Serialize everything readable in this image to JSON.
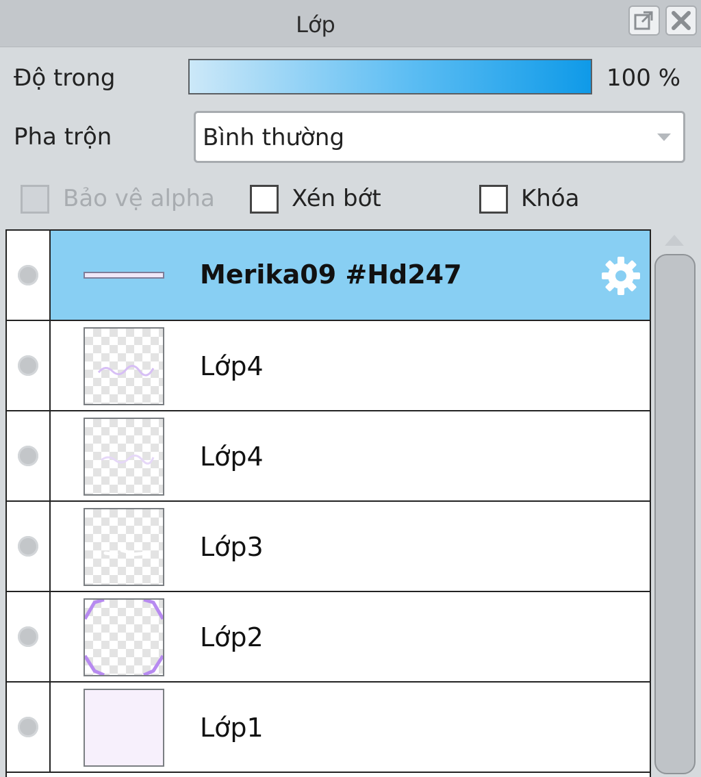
{
  "panel": {
    "title": "Lớp",
    "popout_icon": "popout-icon",
    "close_icon": "close-icon"
  },
  "opacity": {
    "label": "Độ trong",
    "value": "100 %",
    "level": 1.0,
    "gradient_colors": [
      "#cce8f8",
      "#0f9ae8"
    ]
  },
  "blend": {
    "label": "Pha trộn",
    "selected": "Bình thường"
  },
  "options": [
    {
      "label": "Bảo vệ alpha",
      "checked": false,
      "enabled": false
    },
    {
      "label": "Xén bớt",
      "checked": false,
      "enabled": true
    },
    {
      "label": "Khóa",
      "checked": false,
      "enabled": true
    }
  ],
  "layers": [
    {
      "name": "Merika09 #Hd247",
      "type": "folder",
      "selected": true,
      "icon": "gear-icon"
    },
    {
      "name": "Lớp4",
      "type": "layer",
      "selected": false,
      "thumbnail": "faint-purple-text"
    },
    {
      "name": "Lớp4",
      "type": "layer",
      "selected": false,
      "thumbnail": "faint-purple-text"
    },
    {
      "name": "Lớp3",
      "type": "layer",
      "selected": false,
      "thumbnail": "white-marks"
    },
    {
      "name": "Lớp2",
      "type": "layer",
      "selected": false,
      "thumbnail": "purple-corner-frame"
    },
    {
      "name": "Lớp1",
      "type": "layer",
      "selected": false,
      "thumbnail": "light-lavender-fill"
    }
  ],
  "colors": {
    "selected_row": "#88cff3",
    "panel_bg": "#d6dadd",
    "titlebar_bg": "#c3c7cb"
  }
}
